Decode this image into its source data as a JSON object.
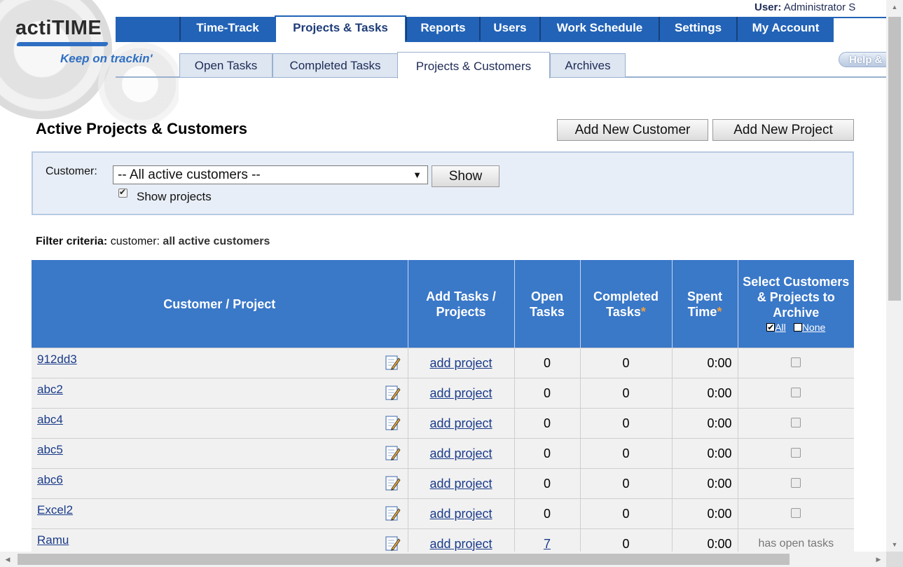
{
  "header": {
    "logo_text": "actiTIME",
    "tagline": "Keep on trackin'",
    "user_label": "User:",
    "user_name": "Administrator S",
    "help_label": "Help &"
  },
  "main_nav": [
    {
      "label": "Time-Track",
      "active": false
    },
    {
      "label": "Projects & Tasks",
      "active": true
    },
    {
      "label": "Reports",
      "active": false
    },
    {
      "label": "Users",
      "active": false
    },
    {
      "label": "Work Schedule",
      "active": false
    },
    {
      "label": "Settings",
      "active": false
    },
    {
      "label": "My Account",
      "active": false
    }
  ],
  "sub_nav": [
    {
      "label": "Open Tasks",
      "active": false
    },
    {
      "label": "Completed Tasks",
      "active": false
    },
    {
      "label": "Projects & Customers",
      "active": true
    },
    {
      "label": "Archives",
      "active": false
    }
  ],
  "page": {
    "title": "Active Projects & Customers",
    "add_customer_label": "Add New Customer",
    "add_project_label": "Add New Project"
  },
  "filter": {
    "customer_label": "Customer:",
    "customer_selected": "-- All active customers --",
    "select_arrow": "▼",
    "show_button": "Show",
    "show_projects_label": "Show projects",
    "show_projects_checked": true,
    "criteria_label": "Filter criteria:",
    "criteria_key": "customer:",
    "criteria_value": "all active customers"
  },
  "table": {
    "headers": {
      "customer_project": "Customer / Project",
      "add_tasks": "Add Tasks / Projects",
      "open_tasks": "Open Tasks",
      "completed_tasks": "Completed Tasks",
      "completed_star": "*",
      "spent_time": "Spent Time",
      "spent_star": "*",
      "select_archive": "Select Customers & Projects to Archive",
      "all_link": "All",
      "none_link": "None"
    },
    "rows": [
      {
        "name": "912dd3",
        "add": "add project",
        "open": "0",
        "completed": "0",
        "spent": "0:00",
        "archive_note": ""
      },
      {
        "name": "abc2",
        "add": "add project",
        "open": "0",
        "completed": "0",
        "spent": "0:00",
        "archive_note": ""
      },
      {
        "name": "abc4",
        "add": "add project",
        "open": "0",
        "completed": "0",
        "spent": "0:00",
        "archive_note": ""
      },
      {
        "name": "abc5",
        "add": "add project",
        "open": "0",
        "completed": "0",
        "spent": "0:00",
        "archive_note": ""
      },
      {
        "name": "abc6",
        "add": "add project",
        "open": "0",
        "completed": "0",
        "spent": "0:00",
        "archive_note": ""
      },
      {
        "name": "Excel2",
        "add": "add project",
        "open": "0",
        "completed": "0",
        "spent": "0:00",
        "archive_note": ""
      },
      {
        "name": "Ramu",
        "add": "add project",
        "open": "7",
        "completed": "0",
        "spent": "0:00",
        "archive_note": "has open tasks"
      }
    ]
  },
  "colors": {
    "nav_blue": "#2263b7",
    "header_blue": "#3a78c8",
    "link_blue": "#1a3b8a",
    "star_orange": "#f0a040"
  }
}
